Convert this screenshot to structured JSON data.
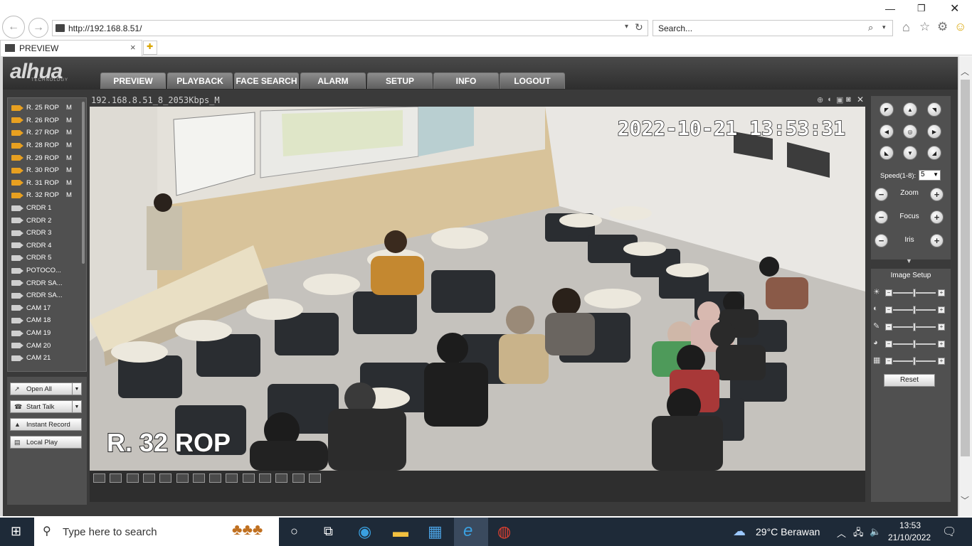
{
  "browser": {
    "url": "http://192.168.8.51/",
    "search_placeholder": "Search...",
    "tab_title": "PREVIEW"
  },
  "app": {
    "logo": "alhua",
    "logo_sub": "TECHNOLOGY",
    "nav": [
      "PREVIEW",
      "PLAYBACK",
      "FACE SEARCH",
      "ALARM",
      "SETUP",
      "INFO",
      "LOGOUT"
    ],
    "active_nav": "PREVIEW"
  },
  "cameras": [
    {
      "label": "R. 25 ROP",
      "suffix": "M",
      "status": "on"
    },
    {
      "label": "R. 26 ROP",
      "suffix": "M",
      "status": "on"
    },
    {
      "label": "R. 27 ROP",
      "suffix": "M",
      "status": "on"
    },
    {
      "label": "R. 28 ROP",
      "suffix": "M",
      "status": "on"
    },
    {
      "label": "R. 29 ROP",
      "suffix": "M",
      "status": "on"
    },
    {
      "label": "R. 30 ROP",
      "suffix": "M",
      "status": "on"
    },
    {
      "label": "R. 31 ROP",
      "suffix": "M",
      "status": "on"
    },
    {
      "label": "R. 32 ROP",
      "suffix": "M",
      "status": "on"
    },
    {
      "label": "CRDR 1",
      "suffix": "",
      "status": "off"
    },
    {
      "label": "CRDR 2",
      "suffix": "",
      "status": "off"
    },
    {
      "label": "CRDR 3",
      "suffix": "",
      "status": "off"
    },
    {
      "label": "CRDR 4",
      "suffix": "",
      "status": "off"
    },
    {
      "label": "CRDR 5",
      "suffix": "",
      "status": "off"
    },
    {
      "label": "POTOCO...",
      "suffix": "",
      "status": "off"
    },
    {
      "label": "CRDR SA...",
      "suffix": "",
      "status": "off"
    },
    {
      "label": "CRDR SA...",
      "suffix": "",
      "status": "off"
    },
    {
      "label": "CAM 17",
      "suffix": "",
      "status": "off"
    },
    {
      "label": "CAM 18",
      "suffix": "",
      "status": "off"
    },
    {
      "label": "CAM 19",
      "suffix": "",
      "status": "off"
    },
    {
      "label": "CAM 20",
      "suffix": "",
      "status": "off"
    },
    {
      "label": "CAM 21",
      "suffix": "",
      "status": "off"
    }
  ],
  "controls": {
    "open_all": "Open All",
    "start_talk": "Start Talk",
    "instant_record": "Instant Record",
    "local_play": "Local Play"
  },
  "video": {
    "stream_title": "192.168.8.51_8_2053Kbps_M",
    "timestamp": "2022-10-21  13:53:31",
    "overlay_label": "R. 32 ROP"
  },
  "ptz": {
    "speed_label": "Speed(1-8):",
    "speed_value": "5",
    "zoom": "Zoom",
    "focus": "Focus",
    "iris": "Iris"
  },
  "image_setup": {
    "title": "Image Setup",
    "reset": "Reset"
  },
  "taskbar": {
    "search_placeholder": "Type here to search",
    "weather": "29°C  Berawan",
    "time": "13:53",
    "date": "21/10/2022"
  },
  "colors": {
    "active_cam": "#e8a020",
    "app_bg": "#3a3a3a",
    "taskbar": "#1e2a38"
  }
}
